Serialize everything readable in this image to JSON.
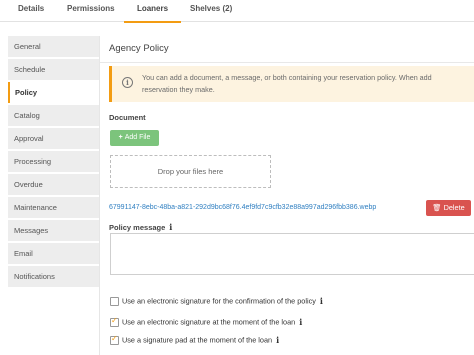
{
  "tabs": [
    {
      "label": "Details"
    },
    {
      "label": "Permissions"
    },
    {
      "label": "Loaners"
    },
    {
      "label": "Shelves (2)"
    }
  ],
  "sidebar": {
    "items": [
      {
        "label": "General"
      },
      {
        "label": "Schedule"
      },
      {
        "label": "Policy"
      },
      {
        "label": "Catalog"
      },
      {
        "label": "Approval"
      },
      {
        "label": "Processing"
      },
      {
        "label": "Overdue"
      },
      {
        "label": "Maintenance"
      },
      {
        "label": "Messages"
      },
      {
        "label": "Email"
      },
      {
        "label": "Notifications"
      }
    ],
    "active": "Policy"
  },
  "main": {
    "title": "Agency Policy",
    "alert": {
      "line1": "You can add a document, a message, or both containing your reservation policy. When add",
      "line2": "reservation they make."
    },
    "document_label": "Document",
    "add_file_label": "Add File",
    "dropzone_text": "Drop your files here",
    "file_name": "67991147-8ebc-48ba-a821-292d9bc68f76.4ef9fd7c9cfb32e88a997ad296fbb386.webp",
    "delete_label": "Delete",
    "policy_message_label": "Policy message",
    "checkboxes": [
      {
        "label": "Use an electronic signature for the confirmation of the policy",
        "checked": false
      },
      {
        "label": "Use an electronic signature at the moment of the loan",
        "checked": true
      },
      {
        "label": "Use a signature pad at the moment of the loan",
        "checked": true
      }
    ]
  },
  "colors": {
    "accent": "#f39c12",
    "success": "#7cc47c",
    "danger": "#d9534f",
    "link": "#2f7fc1",
    "alert_bg": "#fdf3e0"
  }
}
